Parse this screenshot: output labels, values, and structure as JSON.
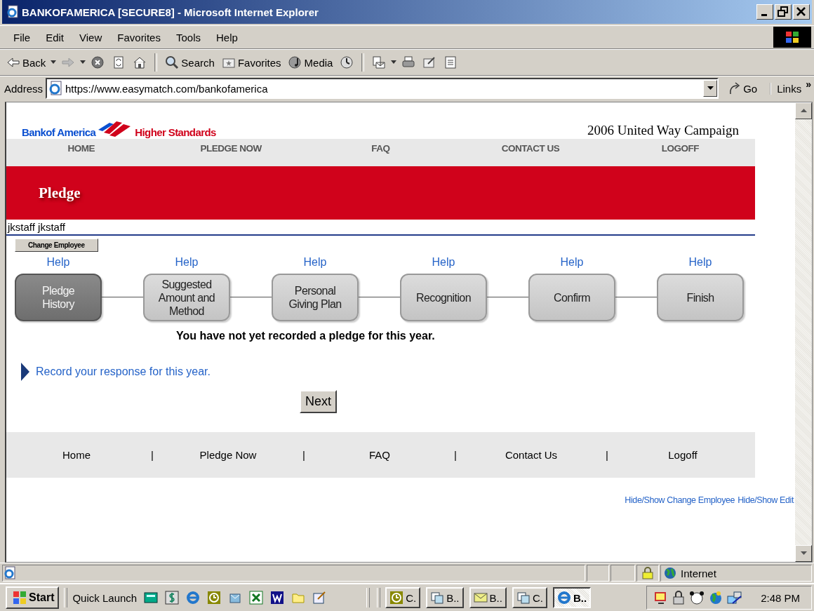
{
  "window": {
    "title": "BANKOFAMERICA [SECURE8] - Microsoft Internet Explorer"
  },
  "menu": [
    "File",
    "Edit",
    "View",
    "Favorites",
    "Tools",
    "Help"
  ],
  "toolbar": [
    {
      "kind": "back",
      "label": "Back"
    },
    {
      "kind": "forward"
    },
    {
      "kind": "stop"
    },
    {
      "kind": "refresh"
    },
    {
      "kind": "home"
    },
    {
      "kind": "search",
      "label": "Search"
    },
    {
      "kind": "favorites",
      "label": "Favorites"
    },
    {
      "kind": "media",
      "label": "Media"
    },
    {
      "kind": "history"
    },
    {
      "kind": "mail"
    },
    {
      "kind": "print"
    },
    {
      "kind": "edit"
    },
    {
      "kind": "discuss"
    }
  ],
  "address": {
    "label": "Address",
    "url": "https://www.easymatch.com/bankofamerica",
    "go": "Go",
    "links": "Links",
    "chevron": "»"
  },
  "page": {
    "brand": "Bankof America",
    "tagline": "Higher Standards",
    "campaign": "2006 United Way Campaign",
    "nav": [
      "HOME",
      "PLEDGE NOW",
      "FAQ",
      "CONTACT US",
      "LOGOFF"
    ],
    "banner": "Pledge",
    "user": "jkstaff jkstaff",
    "change_button": "Change Employee",
    "steps": [
      {
        "help": "Help",
        "label": "Pledge History",
        "selected": true
      },
      {
        "help": "Help",
        "label": "Suggested Amount and Method",
        "selected": false
      },
      {
        "help": "Help",
        "label": "Personal Giving Plan",
        "selected": false
      },
      {
        "help": "Help",
        "label": "Recognition",
        "selected": false
      },
      {
        "help": "Help",
        "label": "Confirm",
        "selected": false
      },
      {
        "help": "Help",
        "label": "Finish",
        "selected": false
      }
    ],
    "message": "You have not yet recorded a pledge for this year.",
    "record_link": "Record your response for this year.",
    "next_button": "Next",
    "footer": {
      "links": [
        "Home",
        "Pledge Now",
        "FAQ",
        "Contact Us",
        "Logoff"
      ],
      "separators": [
        "|",
        "|",
        "|",
        "|"
      ]
    },
    "admin_links": [
      "Hide/Show Change Employee",
      "Hide/Show Edit"
    ]
  },
  "status_bar": {
    "zone": "Internet"
  },
  "taskbar": {
    "start": "Start",
    "quick_launch": "Quick Launch",
    "tasks": [
      {
        "kind": "clock",
        "label": "C.",
        "selected": false
      },
      {
        "kind": "window",
        "label": "B..",
        "selected": false
      },
      {
        "kind": "mail",
        "label": "B..",
        "selected": false
      },
      {
        "kind": "window",
        "label": "C.",
        "selected": false
      },
      {
        "kind": "browser",
        "label": "B..",
        "selected": true
      }
    ],
    "clock": "2:48 PM"
  }
}
